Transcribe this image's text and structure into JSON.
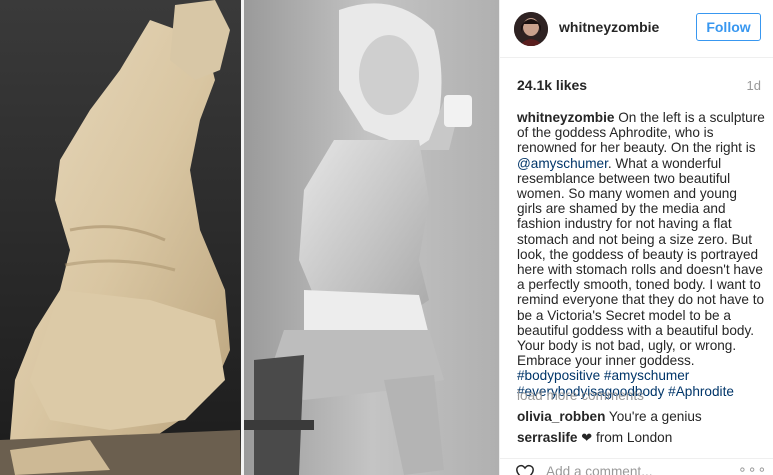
{
  "post": {
    "username": "whitneyzombie",
    "follow_label": "Follow",
    "likes": "24.1k likes",
    "time_ago": "1d"
  },
  "caption": {
    "username": "whitneyzombie",
    "text_1": " On the left is a sculpture of the goddess Aphrodite, who is renowned for her beauty. On the right is ",
    "mention": "@amyschumer",
    "text_2": ". What a wonderful resemblance between two beautiful women. So many women and young girls are shamed by the media and fashion industry for not having a flat stomach and not being a size zero. But look, the goddess of beauty is portrayed here with stomach rolls and doesn't have a perfectly smooth, toned body. I want to remind everyone that they do not have to be a Victoria's Secret model to be a beautiful goddess with a beautiful body. Your body is not bad, ugly, or wrong. Embrace your inner goddess. ",
    "hashtags": [
      "#bodypositive",
      "#amyschumer",
      "#everybodyisagoodbody",
      "#Aphrodite"
    ]
  },
  "comments": {
    "load_more": "load more comments",
    "items": [
      {
        "user": "olivia_robben",
        "text": "You're a genius"
      },
      {
        "user": "serraslife",
        "heart": "❤",
        "text": "from London"
      }
    ]
  },
  "add_comment": {
    "placeholder": "Add a comment...",
    "more": "∘∘∘"
  },
  "icons": {
    "avatar": "avatar-image",
    "like": "heart-outline-icon",
    "more": "more-options-icon"
  },
  "colors": {
    "link_blue": "#3897f0",
    "hashtag": "#003569",
    "muted": "#999999",
    "text": "#262626"
  }
}
